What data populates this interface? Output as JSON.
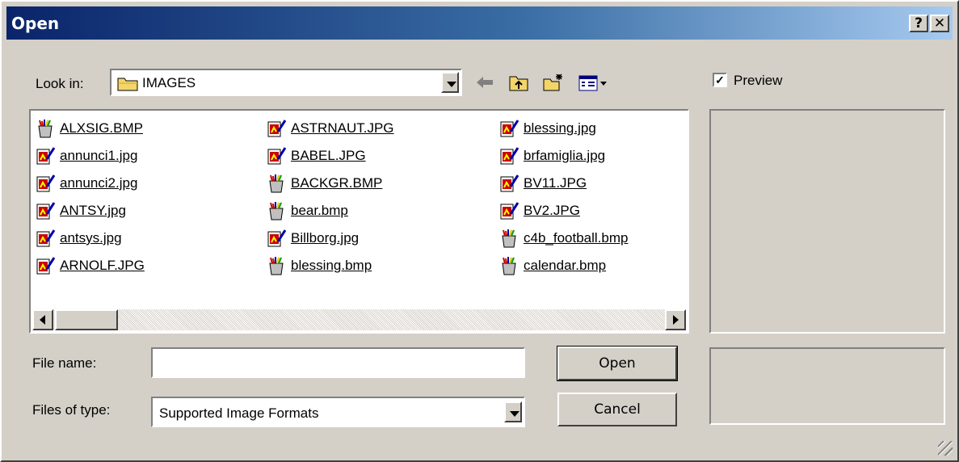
{
  "window": {
    "title": "Open",
    "help_label": "?",
    "close_label": "✕"
  },
  "lookin": {
    "label": "Look in:",
    "value": "IMAGES"
  },
  "preview": {
    "label": "Preview",
    "checked": true
  },
  "files": {
    "columns": [
      [
        {
          "name": "ALXSIG.BMP",
          "type": "bmp"
        },
        {
          "name": "annunci1.jpg",
          "type": "jpg"
        },
        {
          "name": "annunci2.jpg",
          "type": "jpg"
        },
        {
          "name": "ANTSY.jpg",
          "type": "jpg"
        },
        {
          "name": "antsys.jpg",
          "type": "jpg"
        },
        {
          "name": "ARNOLF.JPG",
          "type": "jpg"
        }
      ],
      [
        {
          "name": "ASTRNAUT.JPG",
          "type": "jpg"
        },
        {
          "name": "BABEL.JPG",
          "type": "jpg"
        },
        {
          "name": "BACKGR.BMP",
          "type": "bmp"
        },
        {
          "name": "bear.bmp",
          "type": "bmp"
        },
        {
          "name": "Billborg.jpg",
          "type": "jpg"
        },
        {
          "name": "blessing.bmp",
          "type": "bmp"
        }
      ],
      [
        {
          "name": "blessing.jpg",
          "type": "jpg"
        },
        {
          "name": "brfamiglia.jpg",
          "type": "jpg"
        },
        {
          "name": "BV11.JPG",
          "type": "jpg"
        },
        {
          "name": "BV2.JPG",
          "type": "jpg"
        },
        {
          "name": "c4b_football.bmp",
          "type": "bmp"
        },
        {
          "name": "calendar.bmp",
          "type": "bmp"
        }
      ]
    ]
  },
  "filename": {
    "label": "File name:",
    "value": ""
  },
  "filetype": {
    "label": "Files of type:",
    "value": "Supported Image Formats"
  },
  "buttons": {
    "open": "Open",
    "cancel": "Cancel"
  },
  "icons": {
    "back": "back-arrow-icon",
    "up": "up-folder-icon",
    "newfolder": "new-folder-icon",
    "view": "view-menu-icon"
  }
}
